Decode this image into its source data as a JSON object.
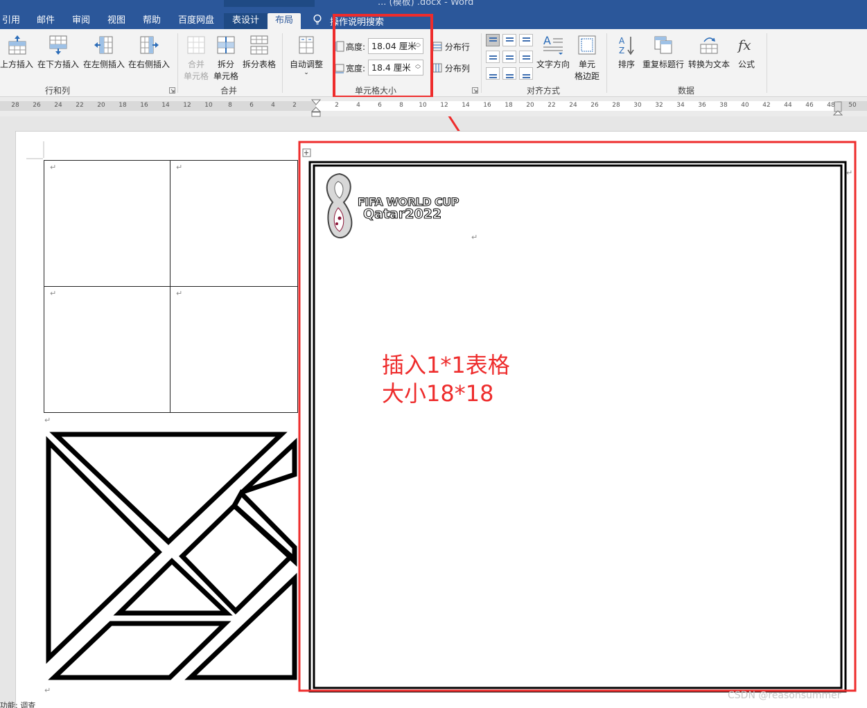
{
  "window": {
    "title_fragment": "... (模板) .docx - Word"
  },
  "tabs": [
    {
      "label": "引用"
    },
    {
      "label": "邮件"
    },
    {
      "label": "审阅"
    },
    {
      "label": "视图"
    },
    {
      "label": "帮助"
    },
    {
      "label": "百度网盘"
    },
    {
      "label": "表设计"
    },
    {
      "label": "布局"
    }
  ],
  "tell_me": "操作说明搜索",
  "ribbon": {
    "rows_cols": {
      "insert_above": "在上方插入",
      "insert_below": "在下方插入",
      "insert_left": "在左侧插入",
      "insert_right": "在右侧插入",
      "group_label": "行和列"
    },
    "merge": {
      "merge_cells_1": "合并",
      "merge_cells_2": "单元格",
      "split_cells_1": "拆分",
      "split_cells_2": "单元格",
      "split_table": "拆分表格",
      "group_label": "合并"
    },
    "cell_size": {
      "autofit": "自动调整",
      "height_label": "高度:",
      "height_value": "18.04 厘米",
      "width_label": "宽度:",
      "width_value": "18.4 厘米",
      "distribute_rows": "分布行",
      "distribute_cols": "分布列",
      "group_label": "单元格大小"
    },
    "alignment": {
      "text_direction": "文字方向",
      "cell_margins_1": "单元",
      "cell_margins_2": "格边距",
      "group_label": "对齐方式"
    },
    "data": {
      "sort": "排序",
      "repeat_header": "重复标题行",
      "convert_to_text": "转换为文本",
      "formula": "公式",
      "group_label": "数据"
    }
  },
  "ruler": {
    "ticks": [
      "28",
      "26",
      "24",
      "22",
      "20",
      "18",
      "16",
      "14",
      "12",
      "10",
      "8",
      "6",
      "4",
      "2",
      "2",
      "4",
      "6",
      "8",
      "10",
      "12",
      "14",
      "16",
      "18",
      "20",
      "22",
      "24",
      "26",
      "28",
      "30",
      "32",
      "34",
      "36",
      "38",
      "40",
      "42",
      "44",
      "46",
      "48",
      "50"
    ]
  },
  "document": {
    "logo_line1": "FIFA WORLD CUP",
    "logo_line2": "Qatar2022",
    "annotation_line1": "插入1*1表格",
    "annotation_line2": "大小18*18"
  },
  "status_bar": {
    "text": "功能: 调查"
  },
  "watermark": "CSDN @reasonsummer",
  "colors": {
    "ribbon_blue": "#2b579a",
    "highlight_red": "#ee2c2c"
  }
}
